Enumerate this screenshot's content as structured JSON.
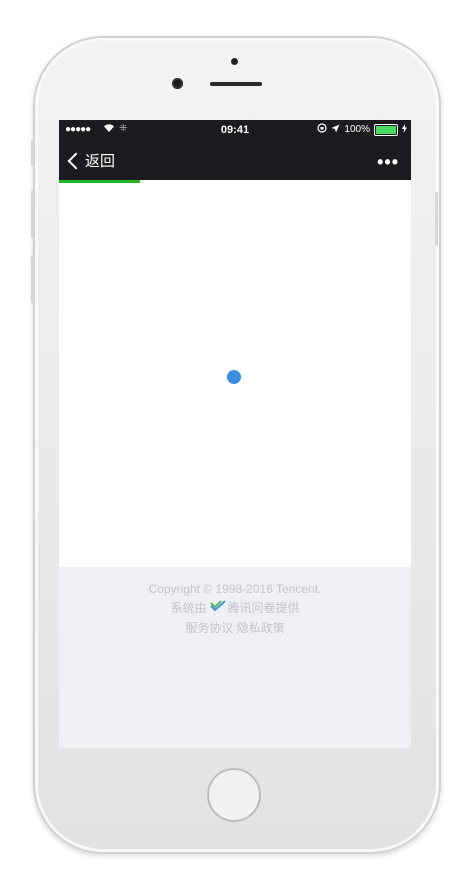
{
  "status_bar": {
    "signal": "●●●●●",
    "time": "09:41",
    "battery_percent": "100%"
  },
  "nav": {
    "back_label": "返回",
    "more_label": "•••"
  },
  "progress": {
    "fraction": 0.23
  },
  "footer": {
    "copyright": "Copyright © 1998-2016 Tencent.",
    "provider_prefix": "系统由",
    "provider_name": "腾讯问卷提供",
    "terms_link": "服务协议",
    "privacy_link": "隐私政策"
  },
  "colors": {
    "nav_background": "#1c1c20",
    "progress_green": "#21b727",
    "loader_blue": "#3c8fdc",
    "battery_green": "#4cd964"
  }
}
